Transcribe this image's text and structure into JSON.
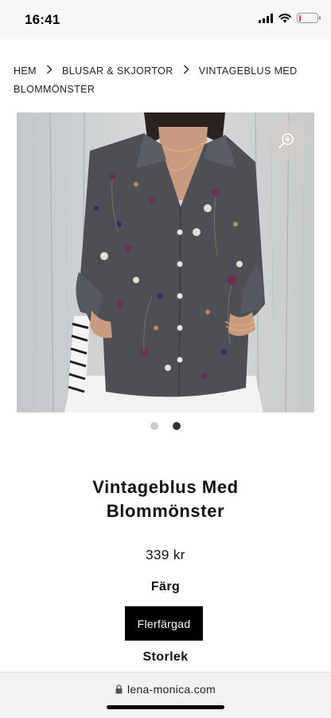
{
  "status_bar": {
    "time": "16:41",
    "signal_icon": "cellular-signal-icon",
    "wifi_icon": "wifi-icon",
    "battery_icon": "battery-low-icon",
    "battery_level": 0.12,
    "battery_color": "#e5403a"
  },
  "breadcrumb": {
    "items": [
      "HEM",
      "BLUSAR & SKJORTOR",
      "VINTAGEBLUS MED BLOMMÖNSTER"
    ],
    "separator_icon": "chevron-right-icon"
  },
  "gallery": {
    "zoom_icon": "zoom-in-icon",
    "image_count": 2,
    "active_index": 1
  },
  "product": {
    "title": "Vintageblus Med Blommönster",
    "price": "339 kr",
    "color_label": "Färg",
    "selected_color": "Flerfärgad",
    "size_label": "Storlek"
  },
  "browser": {
    "lock_icon": "lock-icon",
    "url": "lena-monica.com"
  },
  "colors": {
    "accent": "#000000",
    "blouse": "#4d4f55",
    "background": "#ffffff"
  }
}
